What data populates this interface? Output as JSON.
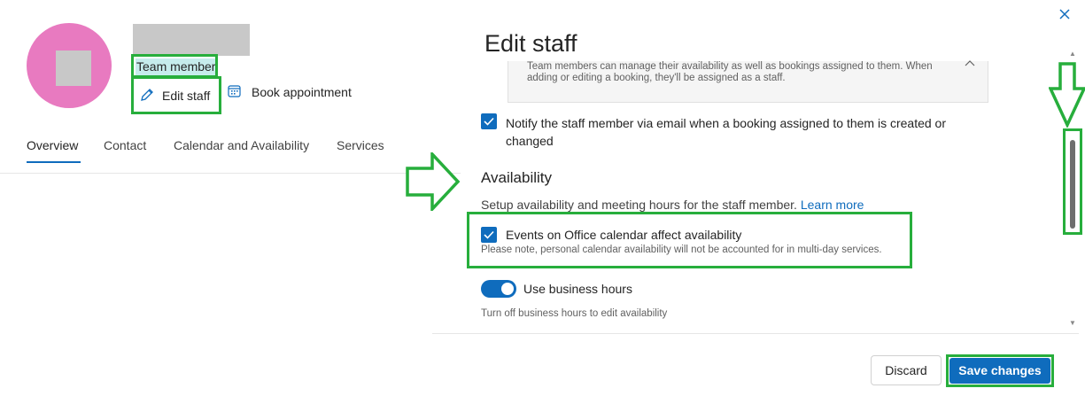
{
  "profile": {
    "role": "Team member",
    "edit_label": "Edit staff",
    "book_label": "Book appointment",
    "avatar_color": "#e87ac0"
  },
  "tabs": [
    {
      "label": "Overview",
      "active": true
    },
    {
      "label": "Contact",
      "active": false
    },
    {
      "label": "Calendar and Availability",
      "active": false
    },
    {
      "label": "Services",
      "active": false
    }
  ],
  "panel": {
    "title": "Edit staff",
    "info_text": "Team members can manage their availability as well as bookings assigned to them. When adding or editing a booking, they'll be assigned as a staff.",
    "notify_label": "Notify the staff member via email when a booking assigned to them is created or changed",
    "notify_checked": true,
    "availability": {
      "heading": "Availability",
      "description": "Setup availability and meeting hours for the staff member.",
      "learn_more": "Learn more",
      "events_label": "Events on Office calendar affect availability",
      "events_checked": true,
      "events_note": "Please note, personal calendar availability will not be accounted for in multi-day services.",
      "business_hours_label": "Use business hours",
      "business_hours_on": true,
      "business_hours_note": "Turn off business hours to edit availability"
    },
    "discard_label": "Discard",
    "save_label": "Save changes"
  },
  "icons": {
    "edit": "pencil-icon",
    "book": "calendar-icon",
    "close": "close-icon",
    "chevron": "chevron-up-icon"
  },
  "colors": {
    "accent": "#0f6cbd",
    "highlight": "#27ae3c"
  }
}
